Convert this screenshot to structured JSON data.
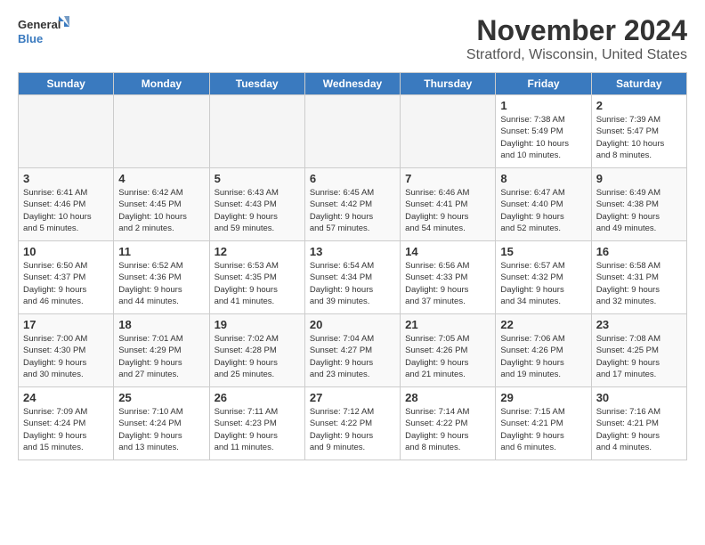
{
  "logo": {
    "line1": "General",
    "line2": "Blue"
  },
  "header": {
    "month": "November 2024",
    "location": "Stratford, Wisconsin, United States"
  },
  "weekdays": [
    "Sunday",
    "Monday",
    "Tuesday",
    "Wednesday",
    "Thursday",
    "Friday",
    "Saturday"
  ],
  "weeks": [
    [
      {
        "day": "",
        "info": ""
      },
      {
        "day": "",
        "info": ""
      },
      {
        "day": "",
        "info": ""
      },
      {
        "day": "",
        "info": ""
      },
      {
        "day": "",
        "info": ""
      },
      {
        "day": "1",
        "info": "Sunrise: 7:38 AM\nSunset: 5:49 PM\nDaylight: 10 hours\nand 10 minutes."
      },
      {
        "day": "2",
        "info": "Sunrise: 7:39 AM\nSunset: 5:47 PM\nDaylight: 10 hours\nand 8 minutes."
      }
    ],
    [
      {
        "day": "3",
        "info": "Sunrise: 6:41 AM\nSunset: 4:46 PM\nDaylight: 10 hours\nand 5 minutes."
      },
      {
        "day": "4",
        "info": "Sunrise: 6:42 AM\nSunset: 4:45 PM\nDaylight: 10 hours\nand 2 minutes."
      },
      {
        "day": "5",
        "info": "Sunrise: 6:43 AM\nSunset: 4:43 PM\nDaylight: 9 hours\nand 59 minutes."
      },
      {
        "day": "6",
        "info": "Sunrise: 6:45 AM\nSunset: 4:42 PM\nDaylight: 9 hours\nand 57 minutes."
      },
      {
        "day": "7",
        "info": "Sunrise: 6:46 AM\nSunset: 4:41 PM\nDaylight: 9 hours\nand 54 minutes."
      },
      {
        "day": "8",
        "info": "Sunrise: 6:47 AM\nSunset: 4:40 PM\nDaylight: 9 hours\nand 52 minutes."
      },
      {
        "day": "9",
        "info": "Sunrise: 6:49 AM\nSunset: 4:38 PM\nDaylight: 9 hours\nand 49 minutes."
      }
    ],
    [
      {
        "day": "10",
        "info": "Sunrise: 6:50 AM\nSunset: 4:37 PM\nDaylight: 9 hours\nand 46 minutes."
      },
      {
        "day": "11",
        "info": "Sunrise: 6:52 AM\nSunset: 4:36 PM\nDaylight: 9 hours\nand 44 minutes."
      },
      {
        "day": "12",
        "info": "Sunrise: 6:53 AM\nSunset: 4:35 PM\nDaylight: 9 hours\nand 41 minutes."
      },
      {
        "day": "13",
        "info": "Sunrise: 6:54 AM\nSunset: 4:34 PM\nDaylight: 9 hours\nand 39 minutes."
      },
      {
        "day": "14",
        "info": "Sunrise: 6:56 AM\nSunset: 4:33 PM\nDaylight: 9 hours\nand 37 minutes."
      },
      {
        "day": "15",
        "info": "Sunrise: 6:57 AM\nSunset: 4:32 PM\nDaylight: 9 hours\nand 34 minutes."
      },
      {
        "day": "16",
        "info": "Sunrise: 6:58 AM\nSunset: 4:31 PM\nDaylight: 9 hours\nand 32 minutes."
      }
    ],
    [
      {
        "day": "17",
        "info": "Sunrise: 7:00 AM\nSunset: 4:30 PM\nDaylight: 9 hours\nand 30 minutes."
      },
      {
        "day": "18",
        "info": "Sunrise: 7:01 AM\nSunset: 4:29 PM\nDaylight: 9 hours\nand 27 minutes."
      },
      {
        "day": "19",
        "info": "Sunrise: 7:02 AM\nSunset: 4:28 PM\nDaylight: 9 hours\nand 25 minutes."
      },
      {
        "day": "20",
        "info": "Sunrise: 7:04 AM\nSunset: 4:27 PM\nDaylight: 9 hours\nand 23 minutes."
      },
      {
        "day": "21",
        "info": "Sunrise: 7:05 AM\nSunset: 4:26 PM\nDaylight: 9 hours\nand 21 minutes."
      },
      {
        "day": "22",
        "info": "Sunrise: 7:06 AM\nSunset: 4:26 PM\nDaylight: 9 hours\nand 19 minutes."
      },
      {
        "day": "23",
        "info": "Sunrise: 7:08 AM\nSunset: 4:25 PM\nDaylight: 9 hours\nand 17 minutes."
      }
    ],
    [
      {
        "day": "24",
        "info": "Sunrise: 7:09 AM\nSunset: 4:24 PM\nDaylight: 9 hours\nand 15 minutes."
      },
      {
        "day": "25",
        "info": "Sunrise: 7:10 AM\nSunset: 4:24 PM\nDaylight: 9 hours\nand 13 minutes."
      },
      {
        "day": "26",
        "info": "Sunrise: 7:11 AM\nSunset: 4:23 PM\nDaylight: 9 hours\nand 11 minutes."
      },
      {
        "day": "27",
        "info": "Sunrise: 7:12 AM\nSunset: 4:22 PM\nDaylight: 9 hours\nand 9 minutes."
      },
      {
        "day": "28",
        "info": "Sunrise: 7:14 AM\nSunset: 4:22 PM\nDaylight: 9 hours\nand 8 minutes."
      },
      {
        "day": "29",
        "info": "Sunrise: 7:15 AM\nSunset: 4:21 PM\nDaylight: 9 hours\nand 6 minutes."
      },
      {
        "day": "30",
        "info": "Sunrise: 7:16 AM\nSunset: 4:21 PM\nDaylight: 9 hours\nand 4 minutes."
      }
    ]
  ]
}
